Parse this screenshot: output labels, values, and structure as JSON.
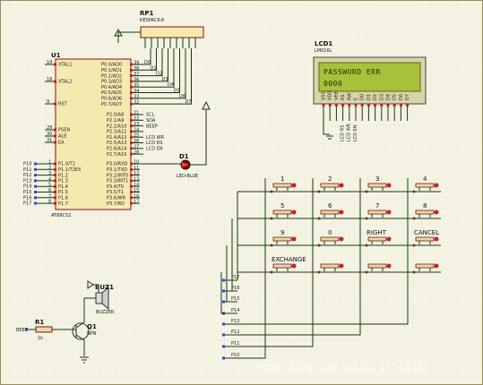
{
  "components": {
    "rp1": {
      "ref": "RP1",
      "part": "RESPACK-8"
    },
    "lcd1": {
      "ref": "LCD1",
      "part": "LM016L",
      "line1": "PASSWORD     ERR",
      "line2": "0000",
      "pins": [
        "VSS",
        "VDD",
        "VEE",
        "RS",
        "RW",
        "E",
        "D0",
        "D1",
        "D2",
        "D3",
        "D4",
        "D5",
        "D6",
        "D7"
      ],
      "nets": [
        "LCD RS",
        "LCD WR",
        "LCD EN"
      ]
    },
    "u1": {
      "ref": "U1",
      "part": "AT89C52",
      "left_pins": [
        {
          "num": "19",
          "name": "XTAL1"
        },
        {
          "num": "18",
          "name": "XTAL2"
        },
        {
          "num": "9",
          "name": "RST"
        },
        {
          "num": "29",
          "name": "PSEN"
        },
        {
          "num": "30",
          "name": "ALE"
        },
        {
          "num": "31",
          "name": "EA"
        }
      ],
      "p1_pins": [
        "P1.0/T2",
        "P1.1/T2EX",
        "P1.2",
        "P1.3",
        "P1.4",
        "P1.5",
        "P1.6",
        "P1.7"
      ],
      "p1_nums": [
        "1",
        "2",
        "3",
        "4",
        "5",
        "6",
        "7",
        "8"
      ],
      "p1_nets": [
        "P10",
        "P11",
        "P12",
        "P13",
        "P14",
        "P15",
        "P16",
        "P17"
      ],
      "p0_pins": [
        "P0.0/AD0",
        "P0.1/AD1",
        "P0.2/AD2",
        "P0.3/AD3",
        "P0.4/AD4",
        "P0.5/AD5",
        "P0.6/AD6",
        "P0.7/AD7"
      ],
      "p0_nums": [
        "39",
        "38",
        "37",
        "36",
        "35",
        "34",
        "33",
        "32"
      ],
      "p0_nets": [
        "D0",
        "D1",
        "D2",
        "D3",
        "D4",
        "D5",
        "D6",
        "D7"
      ],
      "p2_pins": [
        "P2.0/A8",
        "P2.1/A9",
        "P2.2/A10",
        "P2.3/A11",
        "P2.4/A12",
        "P2.5/A13",
        "P2.6/A14",
        "P2.7/A15"
      ],
      "p2_nums": [
        "21",
        "22",
        "23",
        "24",
        "25",
        "26",
        "27",
        "28"
      ],
      "p2_nets": [
        "SCL",
        "SDA",
        "BEEP",
        "",
        "LCD WR",
        "LCD RS",
        "LCD EN",
        ""
      ],
      "p3_pins": [
        "P3.0/RXD",
        "P3.1/TXD",
        "P3.2/INT0",
        "P3.3/INT1",
        "P3.4/T0",
        "P3.5/T1",
        "P3.6/WR",
        "P3.7/RD"
      ],
      "p3_nums": [
        "10",
        "11",
        "12",
        "13",
        "14",
        "15",
        "16",
        "17"
      ]
    },
    "d1": {
      "ref": "D1",
      "part": "LED-BLUE"
    },
    "buz1": {
      "ref": "BUZ1",
      "part": "BUZZER"
    },
    "q1": {
      "ref": "Q1",
      "part": "NPN"
    },
    "r1": {
      "ref": "R1",
      "value": "1k",
      "net": "BEEP"
    }
  },
  "keypad": {
    "keys": [
      "1",
      "2",
      "3",
      "4",
      "5",
      "6",
      "7",
      "8",
      "9",
      "0",
      "RIGHT",
      "CANCEL",
      "EXCHANGE",
      "",
      "",
      ""
    ],
    "row_nets": [
      "P17",
      "P16",
      "P15",
      "P14"
    ],
    "col_nets": [
      "P13",
      "P12",
      "P11",
      "P10"
    ]
  },
  "watermark": "https://blog.csdn.net/qq_45764141"
}
